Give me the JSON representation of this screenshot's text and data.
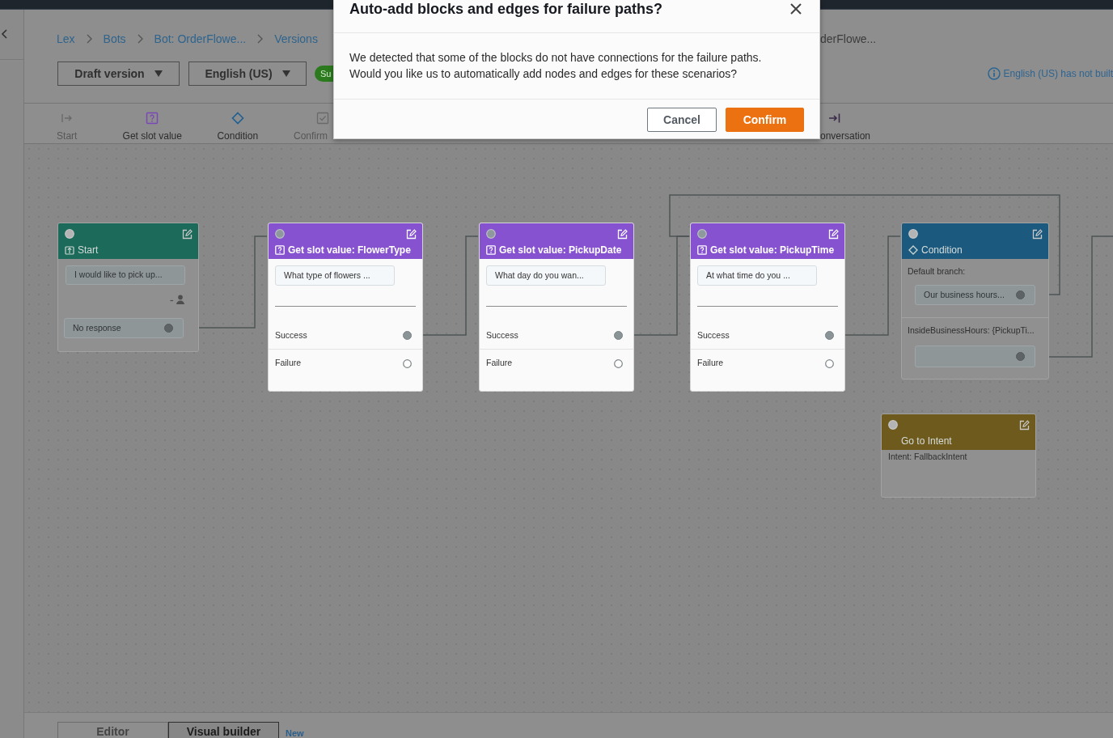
{
  "breadcrumb": [
    {
      "label": "Lex",
      "current": false
    },
    {
      "label": "Bots",
      "current": false
    },
    {
      "label": "Bot: OrderFlowe...",
      "current": false
    },
    {
      "label": "Versions",
      "current": false
    },
    {
      "label": "derFlowe...",
      "current": true
    }
  ],
  "selects": [
    {
      "value": "Draft version"
    },
    {
      "value": "English (US)"
    }
  ],
  "status_badge": {
    "label": "Su"
  },
  "build_notice": {
    "text": "English (US) has not built"
  },
  "toolbar": {
    "items": [
      {
        "kind": "start",
        "label": "Start",
        "disabled": true
      },
      {
        "kind": "get_slot_value",
        "label": "Get slot value",
        "disabled": false
      },
      {
        "kind": "condition",
        "label": "Condition",
        "disabled": false
      },
      {
        "kind": "confirmation",
        "label": "Confirm",
        "disabled": true
      },
      {
        "kind": "end_conversation",
        "label": "onversation",
        "disabled": false
      }
    ]
  },
  "canvas": {
    "blocks": [
      {
        "kind": "start",
        "title": "Start",
        "highlighted": false,
        "utterance": "I would like to pick up...",
        "response": "No response"
      },
      {
        "kind": "get_slot_value",
        "title": "Get slot value: FlowerType",
        "highlighted": true,
        "prompt": "What type of flowers ...",
        "outputs": [
          {
            "label": "Success",
            "connected": true
          },
          {
            "label": "Failure",
            "connected": false
          }
        ]
      },
      {
        "kind": "get_slot_value",
        "title": "Get slot value: PickupDate",
        "highlighted": true,
        "prompt": "What day do you wan...",
        "outputs": [
          {
            "label": "Success",
            "connected": true
          },
          {
            "label": "Failure",
            "connected": false
          }
        ]
      },
      {
        "kind": "get_slot_value",
        "title": "Get slot value: PickupTime",
        "highlighted": true,
        "prompt": "At what time do you ...",
        "outputs": [
          {
            "label": "Success",
            "connected": true
          },
          {
            "label": "Failure",
            "connected": false
          }
        ]
      },
      {
        "kind": "condition",
        "title": "Condition",
        "highlighted": false,
        "branches": [
          {
            "label": "Default branch:",
            "message": "Our business hours...",
            "connected": true
          },
          {
            "label": "InsideBusinessHours: {PickupTi...",
            "connected": true
          }
        ]
      },
      {
        "kind": "go_to_intent",
        "title": "Go to Intent",
        "highlighted": false,
        "detail": "Intent: FallbackIntent"
      }
    ]
  },
  "bottom_tabs": [
    {
      "label": "Editor",
      "selected": false
    },
    {
      "label": "Visual builder",
      "selected": true
    }
  ],
  "new_badge": "New",
  "dialog": {
    "title": "Auto-add blocks and edges for failure paths?",
    "message": "We detected that some of the blocks do not have connections for the failure paths. Would you like us to automatically add nodes and edges for these scenarios?",
    "buttons": [
      {
        "kind": "secondary",
        "label": "Cancel"
      },
      {
        "kind": "primary",
        "label": "Confirm"
      }
    ]
  }
}
